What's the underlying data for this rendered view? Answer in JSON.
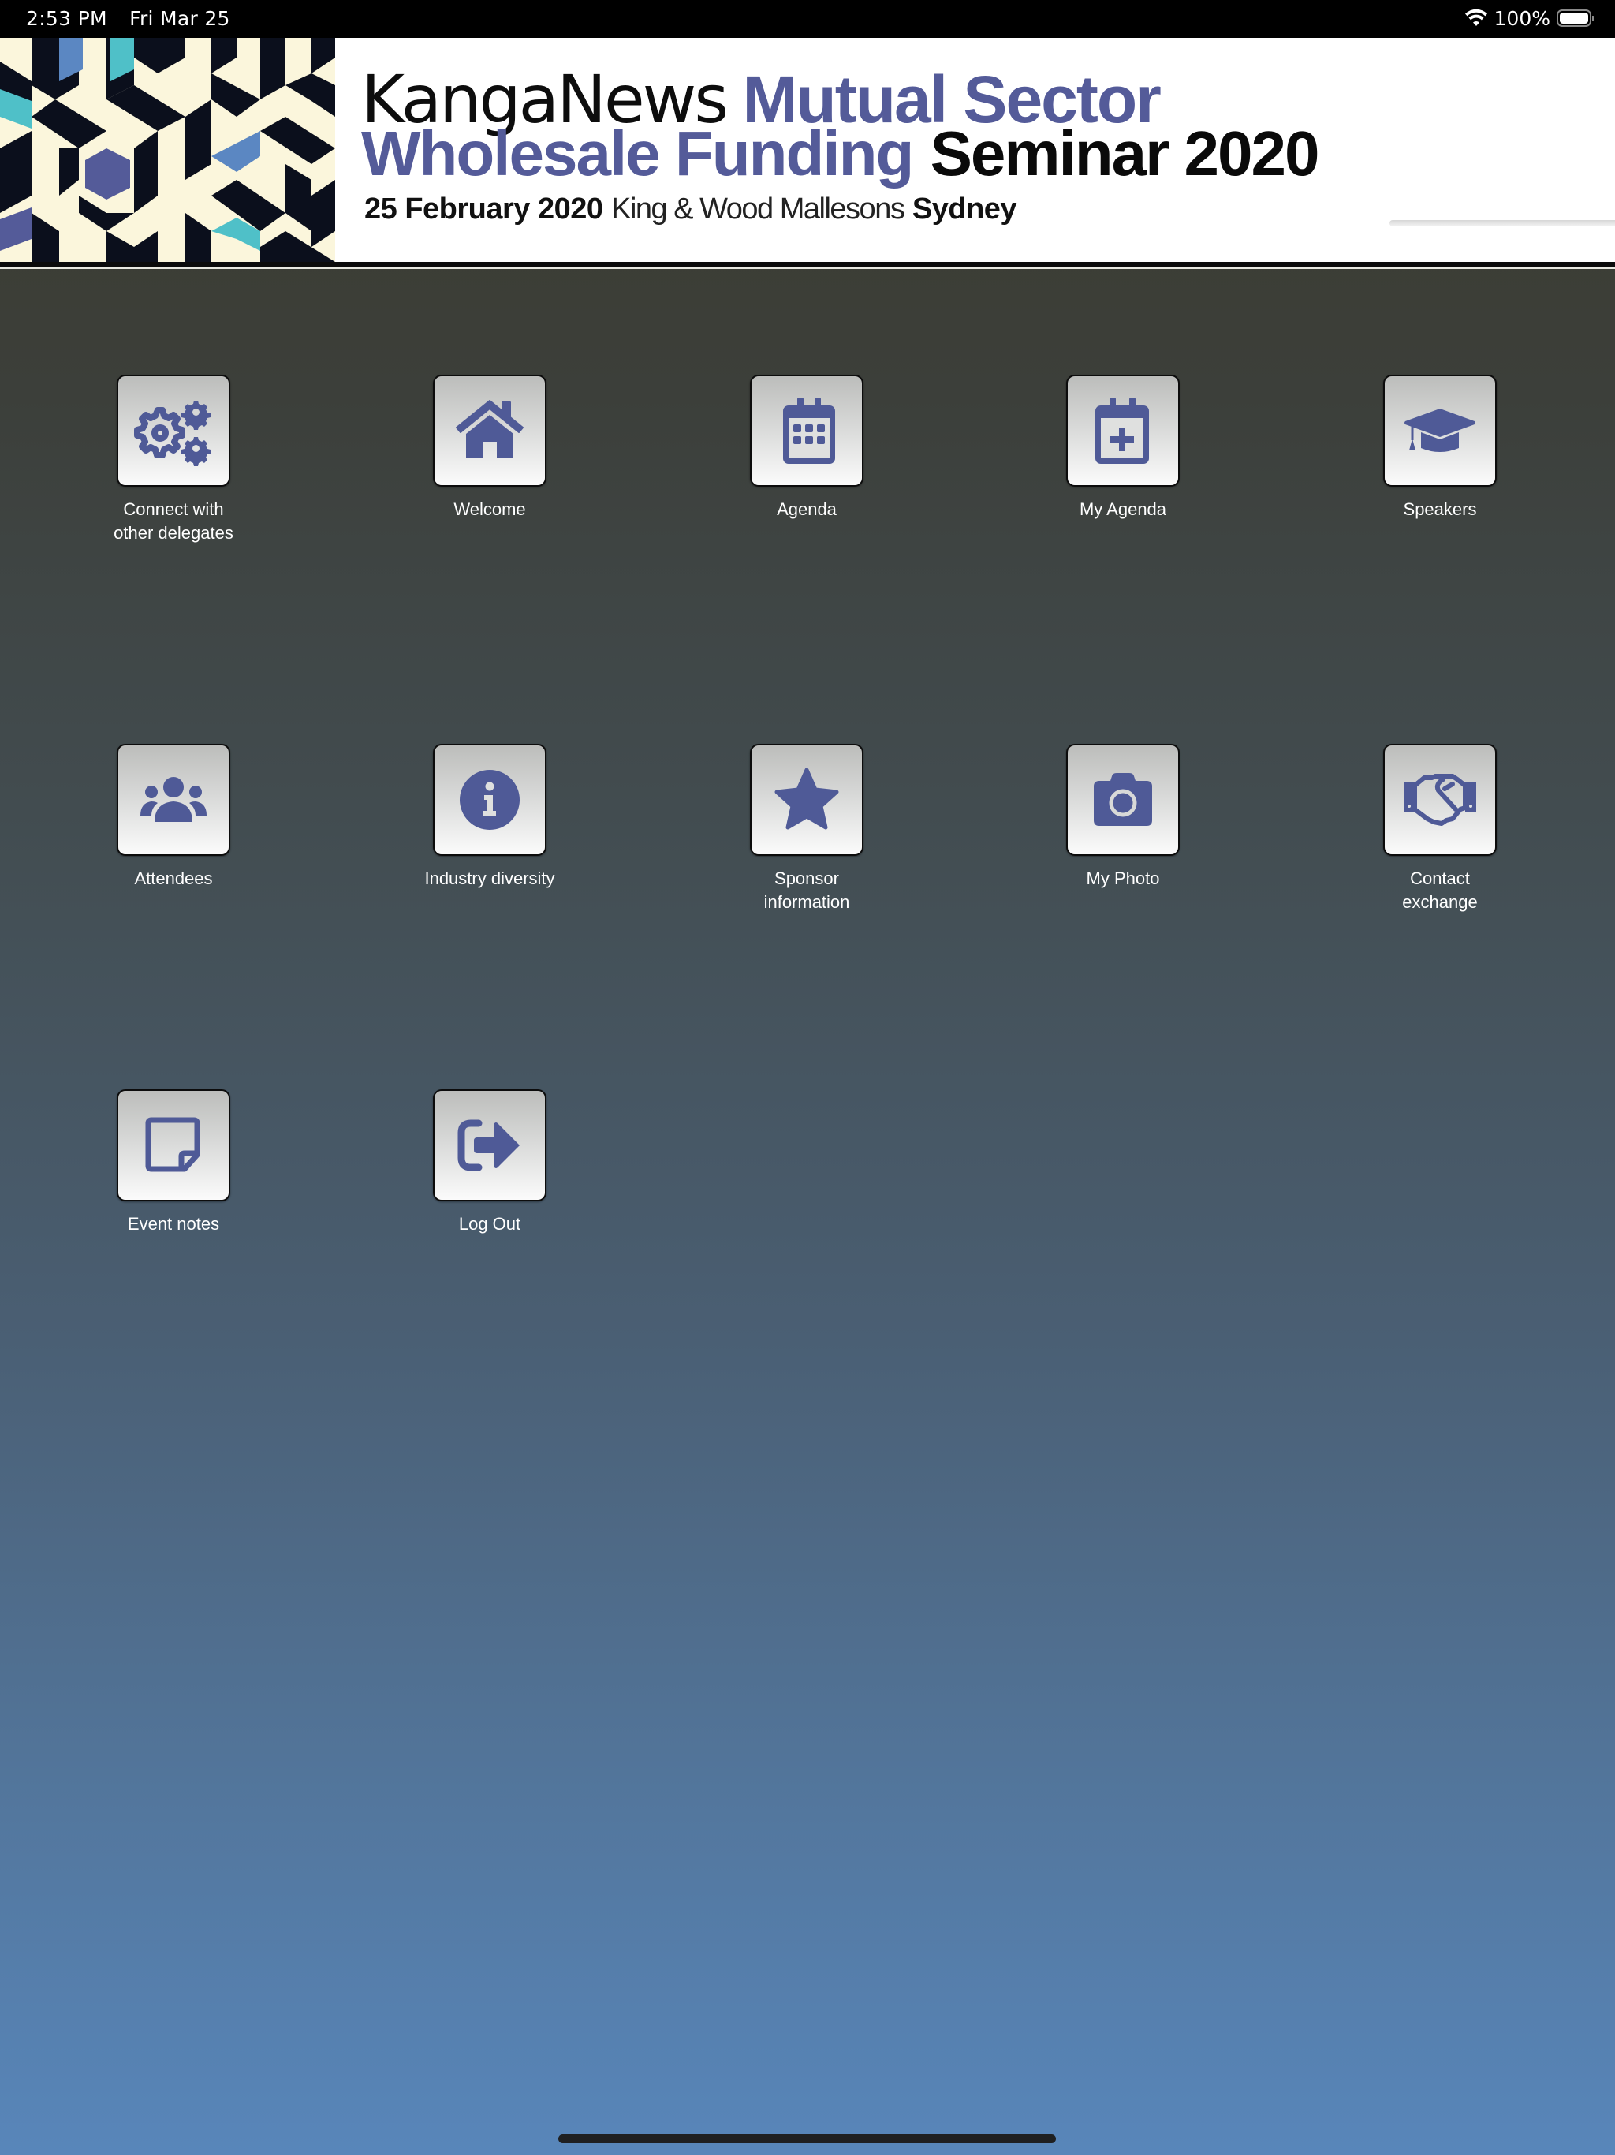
{
  "status_bar": {
    "time": "2:53 PM",
    "date": "Fri Mar 25",
    "battery_percent": "100%",
    "battery_level": 1.0,
    "icons": [
      "wifi-icon",
      "battery-icon"
    ]
  },
  "banner": {
    "brand": "KangaNews",
    "title_accent_1": "Mutual Sector",
    "title_accent_2": "Wholesale Funding",
    "title_dark": "Seminar 2020",
    "date": "25 February 2020",
    "venue": "King & Wood Mallesons",
    "city": "Sydney",
    "colors": {
      "accent": "#545B99",
      "pattern_cream": "#FBF6DC",
      "pattern_navy": "#0B0F1C",
      "pattern_teal": "#4FC0C8",
      "pattern_blue": "#5B87C2",
      "pattern_indigo": "#545B99"
    }
  },
  "menu": {
    "icon_color": "#4F5A97",
    "items": [
      {
        "label": "Connect with other delegates",
        "icon": "gears-icon"
      },
      {
        "label": "Welcome",
        "icon": "home-icon"
      },
      {
        "label": "Agenda",
        "icon": "calendar-icon"
      },
      {
        "label": "My Agenda",
        "icon": "calendar-plus-icon"
      },
      {
        "label": "Speakers",
        "icon": "graduation-cap-icon"
      },
      {
        "label": "Attendees",
        "icon": "users-icon"
      },
      {
        "label": "Industry diversity",
        "icon": "info-icon"
      },
      {
        "label": "Sponsor information",
        "icon": "star-icon"
      },
      {
        "label": "My Photo",
        "icon": "camera-icon"
      },
      {
        "label": "Contact exchange",
        "icon": "handshake-icon"
      },
      {
        "label": "Event notes",
        "icon": "sticky-note-icon"
      },
      {
        "label": "Log Out",
        "icon": "sign-out-icon"
      }
    ]
  }
}
